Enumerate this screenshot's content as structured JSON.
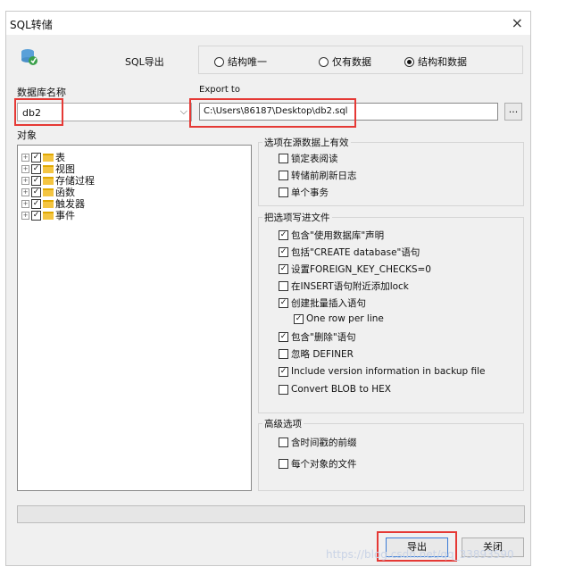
{
  "window": {
    "title": "SQL转储",
    "close_glyph": "×"
  },
  "header": {
    "label": "SQL导出",
    "radios": [
      {
        "label": "结构唯一",
        "selected": false
      },
      {
        "label": "仅有数据",
        "selected": false
      },
      {
        "label": "结构和数据",
        "selected": true
      }
    ]
  },
  "database": {
    "label": "数据库名称",
    "value": "db2",
    "arrow": "⌵"
  },
  "export": {
    "label": "Export to",
    "path": "C:\\Users\\86187\\Desktop\\db2.sql",
    "browse": "..."
  },
  "objects": {
    "label": "对象",
    "items": [
      {
        "label": "表"
      },
      {
        "label": "视图"
      },
      {
        "label": "存储过程"
      },
      {
        "label": "函数"
      },
      {
        "label": "触发器"
      },
      {
        "label": "事件"
      }
    ]
  },
  "source_options": {
    "title": "选项在源数据上有效",
    "items": [
      {
        "label": "锁定表阅读",
        "checked": false
      },
      {
        "label": "转储前刷新日志",
        "checked": false
      },
      {
        "label": "单个事务",
        "checked": false
      }
    ]
  },
  "file_options": {
    "title": "把选项写进文件",
    "items": [
      {
        "label": "包含\"使用数据库\"声明",
        "checked": true
      },
      {
        "label": "包括\"CREATE database\"语句",
        "checked": true
      },
      {
        "label": "设置FOREIGN_KEY_CHECKS=0",
        "checked": true
      },
      {
        "label": "在INSERT语句附近添加lock",
        "checked": false
      },
      {
        "label": "创建批量插入语句",
        "checked": true
      },
      {
        "label": "One row per line",
        "checked": true
      },
      {
        "label": "包含\"删除\"语句",
        "checked": true
      },
      {
        "label": "忽略 DEFINER",
        "checked": false
      },
      {
        "label": "Include version information in backup file",
        "checked": true
      },
      {
        "label": "Convert BLOB to HEX",
        "checked": false
      }
    ]
  },
  "advanced": {
    "title": "高级选项",
    "items": [
      {
        "label": "含时间戳的前缀",
        "checked": false
      },
      {
        "label": "每个对象的文件",
        "checked": false
      }
    ]
  },
  "buttons": {
    "export": "导出",
    "close": "关闭"
  },
  "watermark": "https://blog.csdn.net/qq_33893590",
  "glyphs": {
    "check": "✓",
    "plus": "+"
  }
}
